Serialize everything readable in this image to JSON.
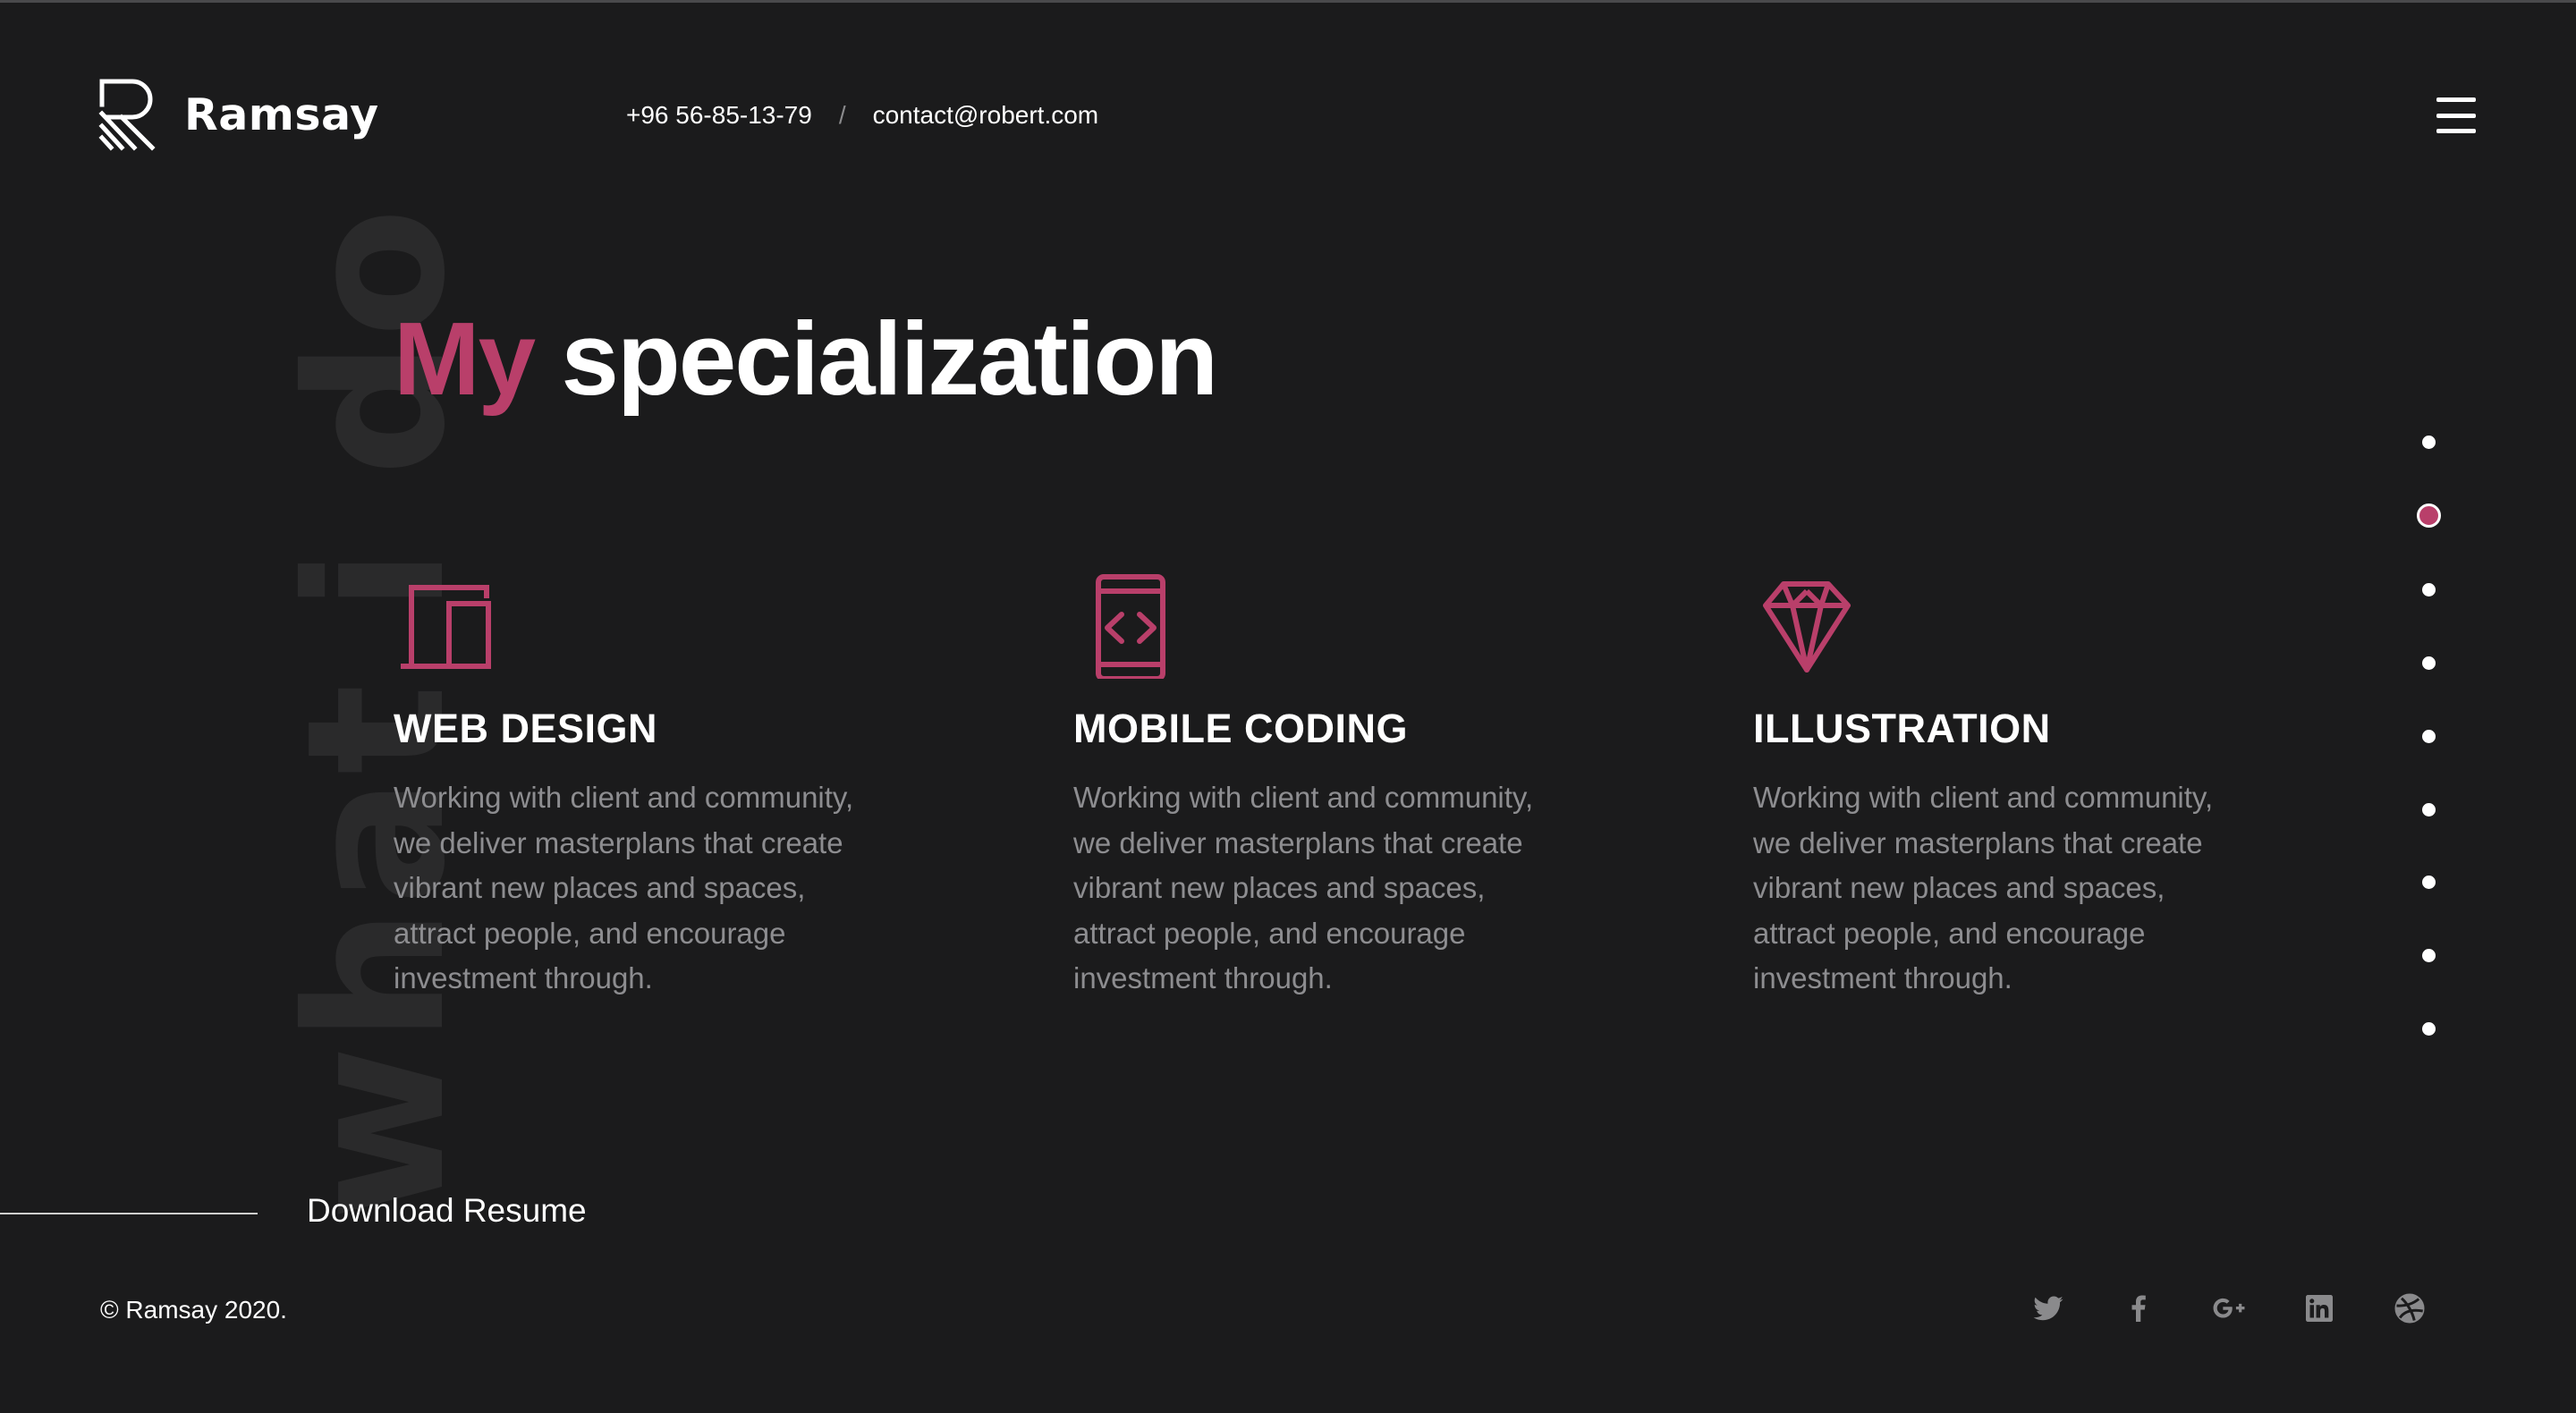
{
  "brand": {
    "name": "Ramsay"
  },
  "header": {
    "phone": "+96 56-85-13-79",
    "separator": "/",
    "email": "contact@robert.com"
  },
  "watermark": "what i do",
  "heading": {
    "accent": "My",
    "rest": "specialization"
  },
  "services": [
    {
      "icon": "devices-icon",
      "title": "WEB DESIGN",
      "description": "Working with client and community, we deliver masterplans that create vibrant new places and spaces, attract people, and encourage investment through."
    },
    {
      "icon": "mobile-code-icon",
      "title": "MOBILE CODING",
      "description": "Working with client and community, we deliver masterplans that create vibrant new places and spaces, attract people, and encourage investment through."
    },
    {
      "icon": "diamond-icon",
      "title": "ILLUSTRATION",
      "description": "Working with client and community, we deliver masterplans that create vibrant new places and spaces, attract people, and encourage investment through."
    }
  ],
  "section_nav": {
    "count": 9,
    "active_index": 1
  },
  "download": {
    "label": "Download Resume"
  },
  "footer": {
    "copyright": "© Ramsay 2020.",
    "socials": [
      "twitter-icon",
      "facebook-icon",
      "google-plus-icon",
      "linkedin-icon",
      "dribbble-icon"
    ]
  },
  "colors": {
    "background": "#1b1b1c",
    "accent": "#b93f6a",
    "text": "#ffffff",
    "muted_text": "#8d8d90",
    "watermark": "#2a2a2b",
    "social_icon": "#8a8a8c"
  }
}
